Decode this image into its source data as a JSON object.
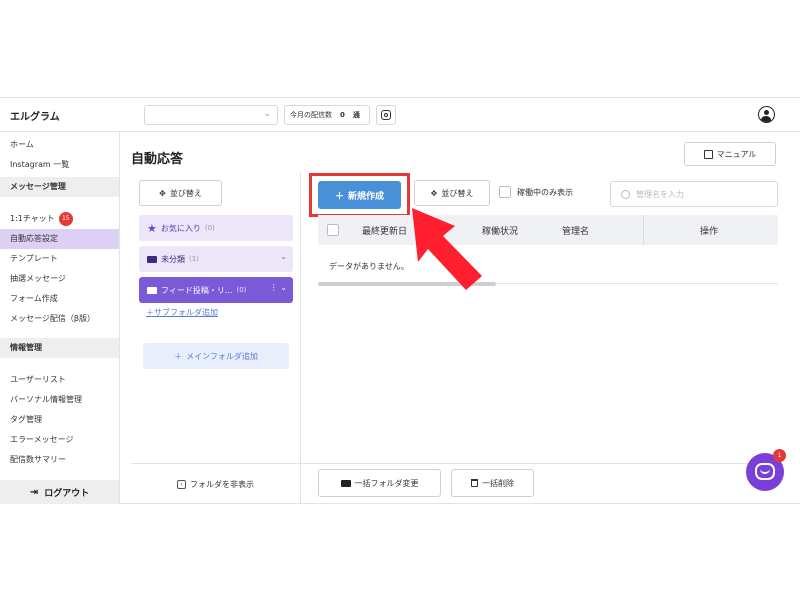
{
  "header": {
    "brand": "エルグラム",
    "account_select_value": "",
    "quota_label": "今月の配信数",
    "quota_count": "0",
    "quota_unit": "通"
  },
  "sidebar": {
    "items_top": [
      {
        "label": "ホーム"
      },
      {
        "label": "Instagram 一覧"
      }
    ],
    "section_message": "メッセージ管理",
    "message_items": [
      {
        "label": "1:1チャット",
        "badge": "15"
      },
      {
        "label": "自動応答設定",
        "active": true
      },
      {
        "label": "テンプレート"
      },
      {
        "label": "抽選メッセージ"
      },
      {
        "label": "フォーム作成"
      },
      {
        "label": "メッセージ配信（β版）"
      }
    ],
    "section_info": "情報管理",
    "info_items": [
      {
        "label": "ユーザーリスト"
      },
      {
        "label": "パーソナル情報管理"
      },
      {
        "label": "タグ管理"
      },
      {
        "label": "エラーメッセージ"
      },
      {
        "label": "配信数サマリー"
      }
    ],
    "logout": "ログアウト"
  },
  "main": {
    "title": "自動応答",
    "manual_button": "マニュアル"
  },
  "folders": {
    "sort_button": "並び替え",
    "favorites": {
      "label": "お気に入り",
      "count": "(0)"
    },
    "uncategorized": {
      "label": "未分類",
      "count": "(1)"
    },
    "feed": {
      "label": "フィード投稿・リ...",
      "count": "(0)"
    },
    "add_subfolder": "サブフォルダ追加",
    "add_main_folder": "メインフォルダ追加",
    "hide_folders": "フォルダを非表示"
  },
  "list": {
    "new_button": "新規作成",
    "sort_button": "並び替え",
    "active_only": "稼働中のみ表示",
    "search_placeholder": "管理名を入力",
    "columns": [
      "最終更新日",
      "稼働状況",
      "管理名",
      "操作"
    ],
    "empty_message": "データがありません。",
    "bulk_move": "一括フォルダ変更",
    "bulk_delete": "一括削除"
  },
  "chat_widget": {
    "badge": "1"
  },
  "colors": {
    "accent_purple": "#7b5ad7",
    "primary_blue": "#4a90d9",
    "highlight_red": "#e53935"
  }
}
